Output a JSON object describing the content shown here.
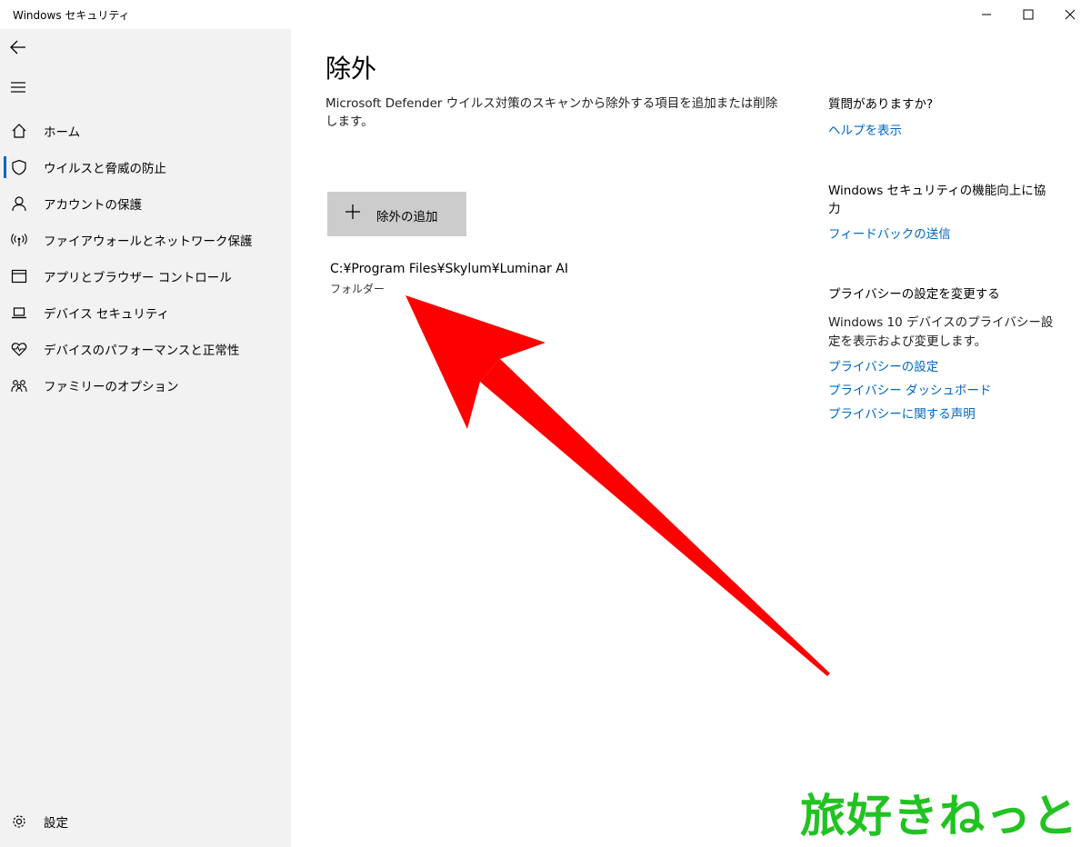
{
  "window": {
    "title": "Windows セキュリティ"
  },
  "sidebar": {
    "items": [
      {
        "label": "ホーム",
        "icon": "home-icon"
      },
      {
        "label": "ウイルスと脅威の防止",
        "icon": "shield-icon"
      },
      {
        "label": "アカウントの保護",
        "icon": "person-icon"
      },
      {
        "label": "ファイアウォールとネットワーク保護",
        "icon": "wireless-icon"
      },
      {
        "label": "アプリとブラウザー コントロール",
        "icon": "browser-window-icon"
      },
      {
        "label": "デバイス セキュリティ",
        "icon": "laptop-icon"
      },
      {
        "label": "デバイスのパフォーマンスと正常性",
        "icon": "heart-pulse-icon"
      },
      {
        "label": "ファミリーのオプション",
        "icon": "family-icon"
      }
    ],
    "settings_label": "設定"
  },
  "main": {
    "title": "除外",
    "description": "Microsoft Defender ウイルス対策のスキャンから除外する項目を追加または削除します。",
    "add_button_label": "除外の追加",
    "exclusion": {
      "path": "C:¥Program Files¥Skylum¥Luminar AI",
      "type": "フォルダー"
    }
  },
  "right": {
    "question_heading": "質問がありますか?",
    "help_link": "ヘルプを表示",
    "improve_heading": "Windows セキュリティの機能向上に協力",
    "feedback_link": "フィードバックの送信",
    "privacy_heading": "プライバシーの設定を変更する",
    "privacy_text": "Windows 10 デバイスのプライバシー設定を表示および変更します。",
    "privacy_links": [
      "プライバシーの設定",
      "プライバシー ダッシュボード",
      "プライバシーに関する声明"
    ]
  },
  "watermark": "旅好きねっと",
  "colors": {
    "accent": "#0067c0",
    "annotation_arrow": "#ff0000",
    "watermark": "#22c222",
    "sidebar_bg": "#f2f2f2",
    "button_bg": "#cccccc"
  }
}
